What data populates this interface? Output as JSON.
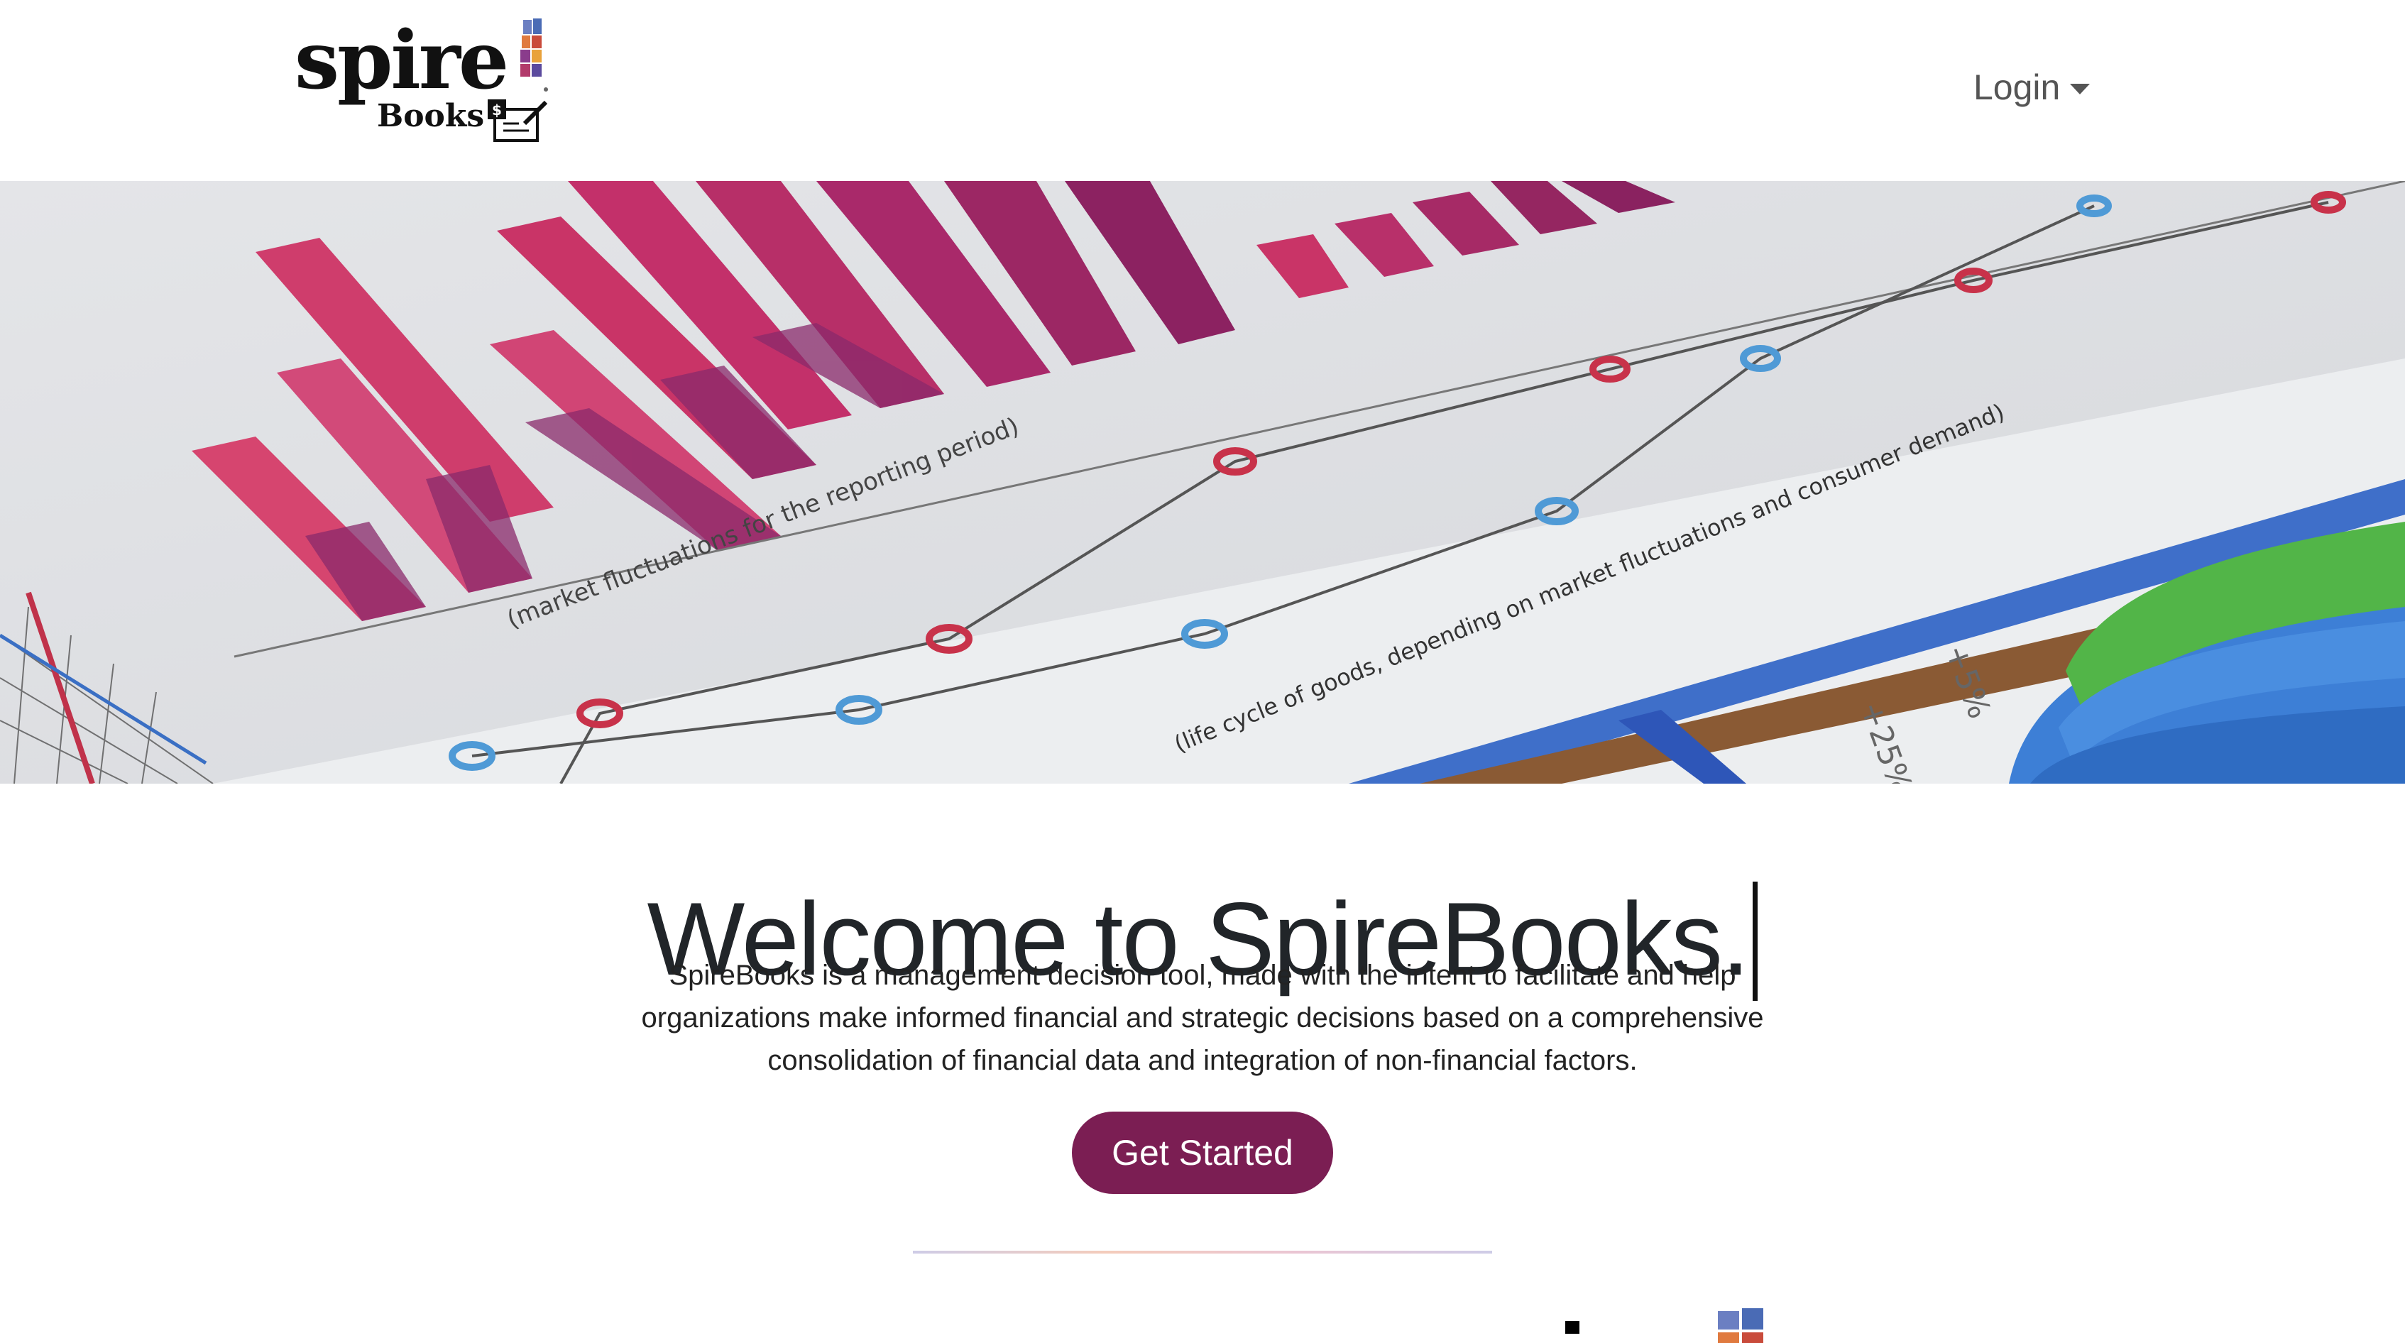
{
  "brand": {
    "logo_word": "spire",
    "logo_sub": "Books",
    "colors": {
      "primary": "#7b1e53",
      "text": "#212529"
    }
  },
  "nav": {
    "login_label": "Login"
  },
  "hero": {
    "image_desc_icon": "financial-charts-photo",
    "caption_texts": [
      "(market fluctuations for the reporting period)",
      "(life cycle of goods, depending on market fluctuations and consumer demand)",
      "+5%",
      "+25%"
    ]
  },
  "main": {
    "title": "Welcome to SpireBooks.",
    "description": "SpireBooks is a management decision tool, made with the intent to facilitate and help organizations make informed financial and strategic decisions based on a comprehensive consolidation of financial data and integration of non-financial factors.",
    "cta_label": "Get Started"
  }
}
